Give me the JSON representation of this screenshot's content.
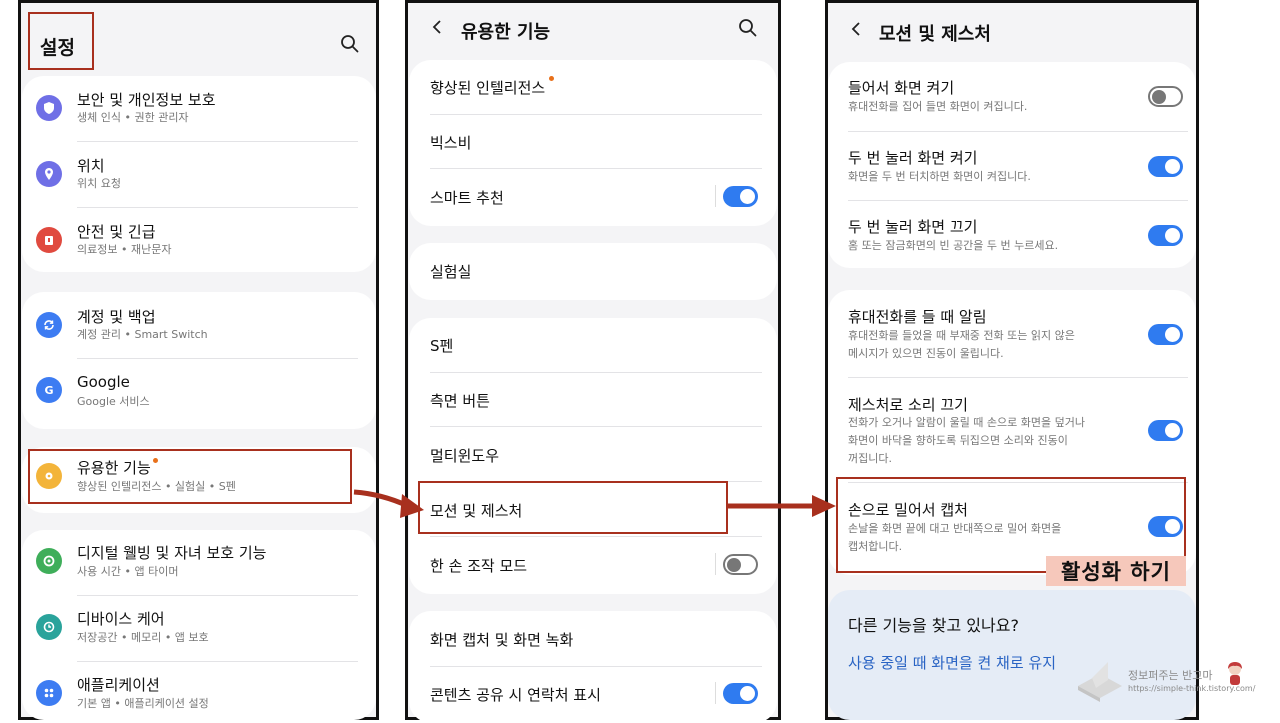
{
  "settings": {
    "title": "설정",
    "groups": [
      [
        {
          "label": "보안 및 개인정보 보호",
          "sub": "생체 인식 • 권한 관리자",
          "icon": "shield-icon",
          "color": "#6f6fe6"
        },
        {
          "label": "위치",
          "sub": "위치 요청",
          "icon": "location-pin-icon",
          "color": "#6f6fe6"
        },
        {
          "label": "안전 및 긴급",
          "sub": "의료정보 • 재난문자",
          "icon": "emergency-icon",
          "color": "#e04a3f"
        }
      ],
      [
        {
          "label": "계정 및 백업",
          "sub": "계정 관리 • Smart Switch",
          "icon": "sync-icon",
          "color": "#3d7cf2"
        },
        {
          "label": "Google",
          "sub": "Google 서비스",
          "icon": "google-icon",
          "color": "#3d7cf2"
        }
      ],
      [
        {
          "label": "유용한 기능",
          "sub": "향상된 인텔리전스 • 실험실 • S펜",
          "icon": "puzzle-gear-icon",
          "color": "#f3b43a"
        }
      ],
      [
        {
          "label": "디지털 웰빙 및 자녀 보호 기능",
          "sub": "사용 시간 • 앱 타이머",
          "icon": "wellbeing-icon",
          "color": "#3fae5a"
        },
        {
          "label": "디바이스 케어",
          "sub": "저장공간 • 메모리 • 앱 보호",
          "icon": "device-care-icon",
          "color": "#2aa39b"
        },
        {
          "label": "애플리케이션",
          "sub": "기본 앱 • 애플리케이션 설정",
          "icon": "apps-grid-icon",
          "color": "#3d7cf2"
        }
      ]
    ]
  },
  "useful": {
    "title": "유용한 기능",
    "items": [
      {
        "label": "향상된 인텔리전스"
      },
      {
        "label": "빅스비"
      },
      {
        "label": "스마트 추천"
      },
      {
        "label": "실험실"
      },
      {
        "label": "S펜"
      },
      {
        "label": "측면 버튼"
      },
      {
        "label": "멀티윈도우"
      },
      {
        "label": "모션 및 제스처"
      },
      {
        "label": "한 손 조작 모드"
      },
      {
        "label": "화면 캡처 및 화면 녹화"
      },
      {
        "label": "콘텐츠 공유 시 연락처 표시"
      }
    ],
    "toggles": {
      "smart": true,
      "onehand": false,
      "contact": true
    }
  },
  "motion": {
    "title": "모션 및 제스처",
    "items": [
      {
        "label": "들어서 화면 켜기",
        "sub": [
          "휴대전화를 집어 들면 화면이 켜집니다."
        ],
        "on": false
      },
      {
        "label": "두 번 눌러 화면 켜기",
        "sub": [
          "화면을 두 번 터치하면 화면이 켜집니다."
        ],
        "on": true
      },
      {
        "label": "두 번 눌러 화면 끄기",
        "sub": [
          "홈 또는 잠금화면의 빈 공간을 두 번 누르세요."
        ],
        "on": true
      },
      {
        "label": "휴대전화를 들 때 알림",
        "sub": [
          "휴대전화를 들었을 때 부재중 전화 또는 읽지 않은",
          "메시지가 있으면 진동이 울립니다."
        ],
        "on": true
      },
      {
        "label": "제스처로 소리 끄기",
        "sub": [
          "전화가 오거나 알람이 울릴 때 손으로 화면을 덮거나",
          "화면이 바닥을 향하도록 뒤집으면 소리와 진동이",
          "꺼집니다."
        ],
        "on": true
      },
      {
        "label": "손으로 밀어서 캡처",
        "sub": [
          "손날을 화면 끝에 대고 반대쪽으로 밀어 화면을",
          "캡처합니다."
        ],
        "on": true
      }
    ],
    "promo_title": "다른 기능을 찾고 있나요?",
    "promo_link": "사용 중일 때 화면을 켠 채로 유지"
  },
  "annotation": "활성화 하기",
  "watermark": {
    "line1": "정보퍼주는 반고마",
    "line2": "https://simple-think.tistory.com/"
  },
  "colors": {
    "accent_blue": "#2f7bf0",
    "annotation_red": "#a8301e",
    "highlight_bg": "#f6c8bb"
  }
}
